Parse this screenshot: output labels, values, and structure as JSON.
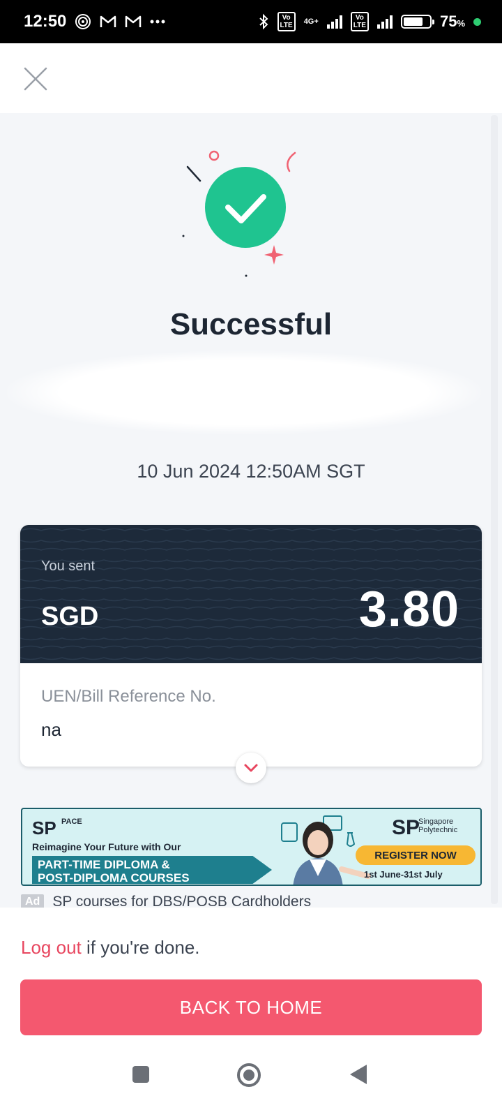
{
  "status_bar": {
    "time": "12:50",
    "notification_icons": [
      "target-icon",
      "gmail-icon",
      "gmail-icon",
      "more-dots-icon"
    ],
    "battery_percent": "75",
    "battery_unit": "%",
    "network_label": "4G+",
    "volte_label": "Vo\nLTE",
    "battery_level": 0.75
  },
  "page": {
    "title": "Successful",
    "datetime": "10 Jun 2024 12:50AM SGT"
  },
  "transfer": {
    "sent_label": "You sent",
    "currency": "SGD",
    "amount": "3.80",
    "reference_label": "UEN/Bill Reference No.",
    "reference_value": "na"
  },
  "ad": {
    "brand_left": "SP",
    "brand_left_sub": "PACE",
    "tagline": "Reimagine Your Future with Our",
    "course_line_1": "PART-TIME DIPLOMA &",
    "course_line_2": "POST-DIPLOMA COURSES",
    "brand_right": "SP",
    "school_name_1": "Singapore",
    "school_name_2": "Polytechnic",
    "cta": "REGISTER NOW",
    "dates": "1st June-31st July",
    "badge": "Ad",
    "caption": "SP courses for DBS/POSB Cardholders"
  },
  "footer": {
    "logout_link": "Log out",
    "logout_suffix": "if you're done.",
    "home_button": "BACK TO HOME"
  },
  "colors": {
    "success_green": "#1fc490",
    "card_dark": "#1d2a3a",
    "accent_pink": "#f4586f",
    "link_red": "#e8465f"
  }
}
